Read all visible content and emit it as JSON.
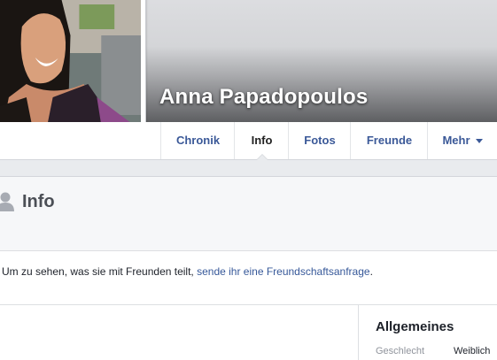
{
  "profile": {
    "name": "Anna Papadopoulos"
  },
  "tabs": [
    {
      "label": "Chronik",
      "active": false
    },
    {
      "label": "Info",
      "active": true
    },
    {
      "label": "Fotos",
      "active": false
    },
    {
      "label": "Freunde",
      "active": false
    },
    {
      "label": "Mehr",
      "active": false,
      "dropdown": true
    }
  ],
  "section": {
    "icon": "person-icon",
    "title": "Info"
  },
  "notice": {
    "text_before": "Um zu sehen, was sie mit Freunden teilt,",
    "link_text": "sende ihr eine Freundschaftsanfrage",
    "text_after": "."
  },
  "sidebar": {
    "title": "Allgemeines",
    "rows": [
      {
        "label": "Geschlecht",
        "value": "Weiblich"
      }
    ]
  },
  "colors": {
    "link": "#3b5998",
    "text": "#1d2129",
    "muted": "#90949c",
    "page_bg": "#e9ebee"
  }
}
